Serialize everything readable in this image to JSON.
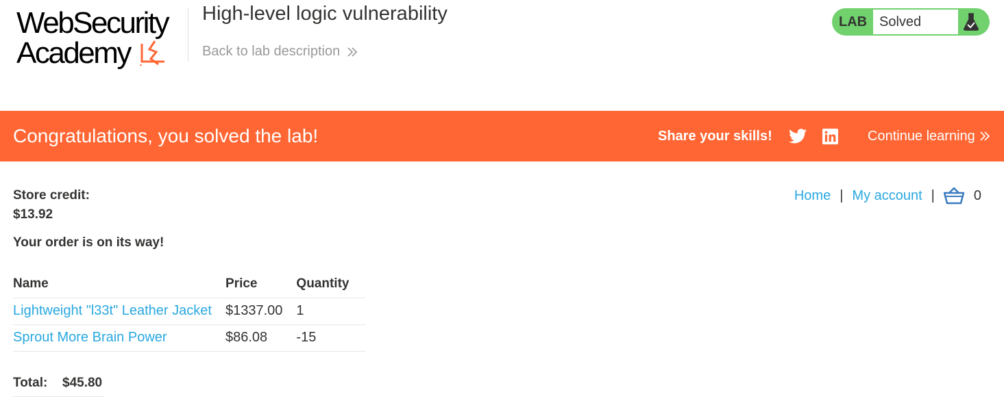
{
  "header": {
    "logo": {
      "line1": "WebSecurity",
      "line2": "Academy",
      "accent_color": "#ff6633"
    },
    "lab_title": "High-level logic vulnerability",
    "back_link": "Back to lab description",
    "lab_status": {
      "badge": "LAB",
      "status": "Solved",
      "icon": "flask-icon",
      "color": "#70d16d"
    }
  },
  "notification": {
    "message": "Congratulations, you solved the lab!",
    "share_label": "Share your skills!",
    "social_icons": [
      "twitter-icon",
      "linkedin-icon"
    ],
    "continue_label": "Continue learning",
    "background": "#ff6633"
  },
  "account": {
    "store_credit_label": "Store credit:",
    "store_credit_value": "$13.92"
  },
  "nav": {
    "home": "Home",
    "separator": "|",
    "my_account": "My account",
    "cart_icon": "basket-icon",
    "cart_count": "0",
    "link_color": "#29a8e0"
  },
  "order": {
    "status_message": "Your order is on its way!",
    "columns": [
      "Name",
      "Price",
      "Quantity"
    ],
    "rows": [
      {
        "name": "Lightweight \"l33t\" Leather Jacket",
        "price": "$1337.00",
        "quantity": "1"
      },
      {
        "name": "Sprout More Brain Power",
        "price": "$86.08",
        "quantity": "-15"
      }
    ],
    "total_label": "Total:",
    "total_value": "$45.80"
  }
}
